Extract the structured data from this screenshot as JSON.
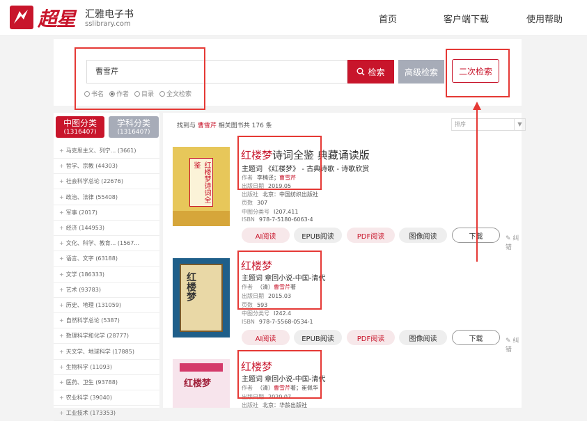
{
  "header": {
    "logo_text": "超星",
    "brand_name": "汇雅电子书",
    "brand_url": "sslibrary.com",
    "nav": [
      "首页",
      "客户端下载",
      "使用帮助"
    ]
  },
  "search": {
    "query": "曹雪芹",
    "search_button": "检索",
    "advanced_button": "高级检索",
    "secondary_button": "二次检索",
    "options": [
      {
        "label": "书名",
        "checked": false
      },
      {
        "label": "作者",
        "checked": true
      },
      {
        "label": "目录",
        "checked": false
      },
      {
        "label": "全文检索",
        "checked": false
      }
    ]
  },
  "sidebar": {
    "tab_cn": {
      "label": "中图分类",
      "count": "(1316407)"
    },
    "tab_subject": {
      "label": "学科分类",
      "count": "(1316407)"
    },
    "categories": [
      "马克思主义、列宁... (3661)",
      "哲学、宗教 (44303)",
      "社会科学总论 (22676)",
      "政治、法律 (55408)",
      "军事 (2017)",
      "经济 (144953)",
      "文化、科学、教育... (1567...",
      "语言、文字 (63188)",
      "文学 (186333)",
      "艺术 (93783)",
      "历史、地理 (131059)",
      "自然科学总论 (5387)",
      "数理科学和化学 (28777)",
      "天文学、地球科学 (17885)",
      "生物科学 (11093)",
      "医药、卫生 (93788)",
      "农业科学 (39040)",
      "工业技术 (173353)"
    ]
  },
  "results": {
    "summary_prefix": "找到与",
    "summary_keyword": "曹雪芹",
    "summary_suffix": "相关图书共 176 条",
    "sort_placeholder": "排序",
    "buttons": {
      "ai": "AI阅读",
      "epub": "EPUB阅读",
      "pdf": "PDF阅读",
      "image": "图像阅读",
      "download": "下载",
      "correct": "纠错"
    },
    "books": [
      {
        "title_hl": "红楼梦",
        "title_rest": "诗词全鉴 典藏诵读版",
        "subject": "主题词 《红楼梦》 - 古典诗歌 - 诗歌欣赏",
        "author_label": "作者",
        "author_plain": "李楠译；",
        "author_hl": "曹雪芹",
        "author_tail": "",
        "date_label": "出版日期",
        "date": "2019.05",
        "pub_label": "出版社",
        "publisher": "北京：中国纺织出版社",
        "pages_label": "页数",
        "pages": "307",
        "cls_label": "中图分类号",
        "cls": "I207.411",
        "isbn_label": "ISBN",
        "isbn": "978-7-5180-6063-4",
        "cover_title": "红楼梦诗词全鉴"
      },
      {
        "title_hl": "红楼梦",
        "title_rest": "",
        "subject": "主题词 章回小说-中国-清代",
        "author_label": "作者",
        "author_plain": "（清）",
        "author_hl": "曹雪芹",
        "author_tail": "著",
        "date_label": "出版日期",
        "date": "2015.03",
        "pages_label": "页数",
        "pages": "593",
        "cls_label": "中图分类号",
        "cls": "I242.4",
        "isbn_label": "ISBN",
        "isbn": "978-7-5568-0534-1",
        "cover_title": "红楼梦"
      },
      {
        "title_hl": "红楼梦",
        "title_rest": "",
        "subject": "主题词 章回小说-中国-清代",
        "author_label": "作者",
        "author_plain": "（清）",
        "author_hl": "曹雪芹",
        "author_tail": "著；崔佩华",
        "date_label": "出版日期",
        "date": "2020.07",
        "pub_label": "出版社",
        "publisher": "北京：华龄出版社",
        "cover_title": "红楼梦"
      }
    ]
  },
  "colors": {
    "brand_red": "#c8152b",
    "gray_button": "#a7acb8",
    "annotation_red": "#e53935"
  }
}
